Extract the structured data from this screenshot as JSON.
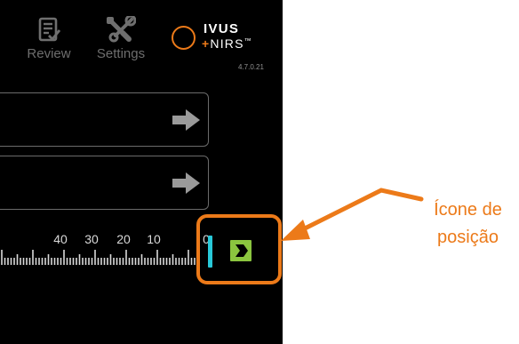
{
  "toolbar": {
    "review_label": "Review",
    "review_icon": "review-icon",
    "settings_label": "Settings",
    "settings_icon": "settings-icon"
  },
  "logo": {
    "line1": "IVUS",
    "plus": "+",
    "line2": "NIRS",
    "tm": "™",
    "version": "4.7.0.21"
  },
  "fields": [
    {
      "arrow_icon": "arrow-right-icon"
    },
    {
      "arrow_icon": "arrow-right-icon"
    }
  ],
  "ruler": {
    "tick_labels": [
      "40",
      "30",
      "20",
      "10",
      "0"
    ]
  },
  "position_button": {
    "icon": "position-icon",
    "fill_color": "#8bc53f"
  },
  "callout": {
    "line1": "Ícone de",
    "line2": "posição",
    "color": "#ec7a19"
  },
  "colors": {
    "screen_background": "#000000",
    "brand_orange": "#ec7a19",
    "cursor_cyan": "#28c9d9",
    "position_green": "#8bc53f"
  }
}
